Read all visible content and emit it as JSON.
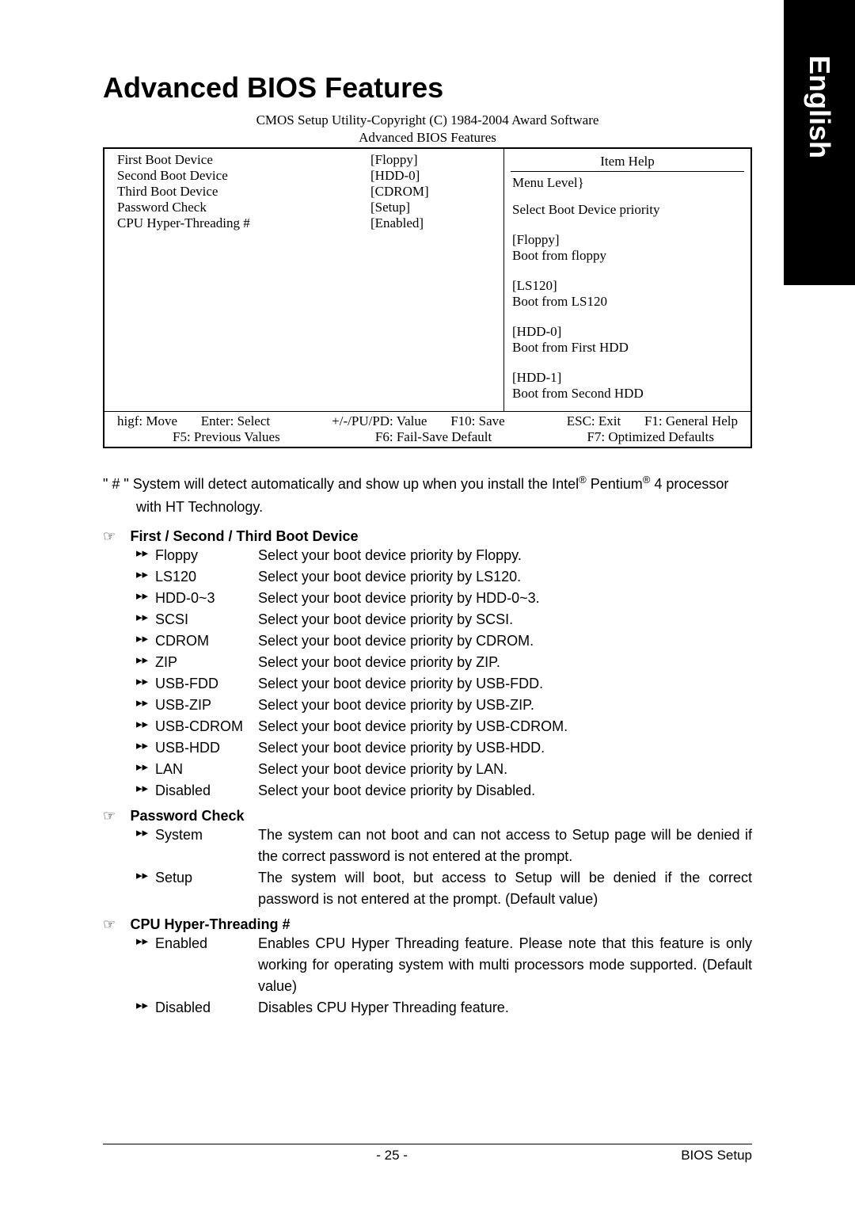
{
  "side_label": "English",
  "page_title": "Advanced BIOS Features",
  "bios_copyright": "CMOS Setup Utility-Copyright (C) 1984-2004 Award Software",
  "bios_screen_title": "Advanced BIOS Features",
  "bios_settings": [
    {
      "label": "First Boot Device",
      "value": "[Floppy]"
    },
    {
      "label": "Second Boot Device",
      "value": "[HDD-0]"
    },
    {
      "label": "Third Boot Device",
      "value": "[CDROM]"
    },
    {
      "label": "Password Check",
      "value": "[Setup]"
    },
    {
      "label": "CPU Hyper-Threading #",
      "value": "[Enabled]"
    }
  ],
  "item_help_title": "Item Help",
  "menu_level": "Menu Level}",
  "help_lead": "Select Boot Device priority",
  "help_items": [
    {
      "t": "[Floppy]",
      "d": "Boot from floppy"
    },
    {
      "t": "[LS120]",
      "d": "Boot from LS120"
    },
    {
      "t": "[HDD-0]",
      "d": "Boot from First HDD"
    },
    {
      "t": "[HDD-1]",
      "d": "Boot from Second HDD"
    }
  ],
  "footer1": {
    "a": "higf: Move",
    "b": "Enter: Select",
    "c": "+/-/PU/PD: Value",
    "d": "F10: Save",
    "e": "ESC: Exit",
    "f": "F1: General Help"
  },
  "footer2": {
    "a": "F5: Previous Values",
    "b": "F6: Fail-Save Default",
    "c": "F7: Optimized Defaults"
  },
  "note_text_1": "\" # \" System will detect automatically and show up when you install the Intel",
  "note_reg1": "®",
  "note_text_2": " Pentium",
  "note_reg2": "®",
  "note_text_3": " 4 processor",
  "note_text_4": "with HT Technology.",
  "sec1_title": "First / Second / Third Boot Device",
  "sec1_options": [
    {
      "name": "Floppy",
      "desc": "Select your boot device priority by Floppy."
    },
    {
      "name": "LS120",
      "desc": "Select your boot device priority by LS120."
    },
    {
      "name": "HDD-0~3",
      "desc": "Select your boot device priority by HDD-0~3."
    },
    {
      "name": "SCSI",
      "desc": "Select your boot device priority by SCSI."
    },
    {
      "name": "CDROM",
      "desc": "Select your boot device priority by CDROM."
    },
    {
      "name": "ZIP",
      "desc": "Select your boot device priority by ZIP."
    },
    {
      "name": "USB-FDD",
      "desc": "Select your boot device priority by USB-FDD."
    },
    {
      "name": "USB-ZIP",
      "desc": "Select your boot device priority by USB-ZIP."
    },
    {
      "name": "USB-CDROM",
      "desc": "Select your boot device priority by USB-CDROM."
    },
    {
      "name": "USB-HDD",
      "desc": "Select your boot device priority by USB-HDD."
    },
    {
      "name": "LAN",
      "desc": "Select your boot device priority by LAN."
    },
    {
      "name": "Disabled",
      "desc": "Select your boot device priority by Disabled."
    }
  ],
  "sec2_title": "Password Check",
  "sec2_options": [
    {
      "name": "System",
      "desc": "The system can not boot and can not access to Setup page will be denied if the correct password is not entered at the prompt."
    },
    {
      "name": "Setup",
      "desc": "The system will boot, but access to Setup will be denied if the correct password is not entered at the prompt. (Default value)"
    }
  ],
  "sec3_title": "CPU Hyper-Threading #",
  "sec3_options": [
    {
      "name": "Enabled",
      "desc": "Enables CPU Hyper Threading feature. Please note that this feature is only working for operating system with multi processors mode supported. (Default value)"
    },
    {
      "name": "Disabled",
      "desc": "Disables CPU Hyper Threading feature."
    }
  ],
  "page_num": "- 25 -",
  "footer_label": "BIOS Setup",
  "hand_icon": "☞",
  "double_arrow": "▸▸"
}
